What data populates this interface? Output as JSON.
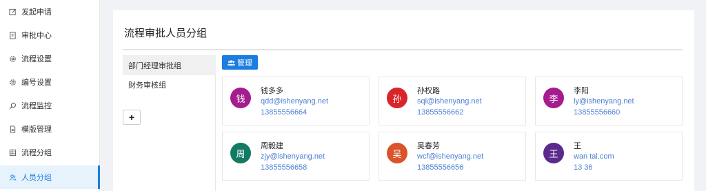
{
  "sidebar": {
    "items": [
      {
        "label": "发起申请",
        "icon": "edit-icon"
      },
      {
        "label": "审批中心",
        "icon": "document-check-icon"
      },
      {
        "label": "流程设置",
        "icon": "gear-icon"
      },
      {
        "label": "编号设置",
        "icon": "gear-icon"
      },
      {
        "label": "流程监控",
        "icon": "search-icon"
      },
      {
        "label": "模版管理",
        "icon": "file-icon"
      },
      {
        "label": "流程分组",
        "icon": "grid-icon"
      },
      {
        "label": "人员分组",
        "icon": "users-icon"
      }
    ],
    "active_index": 7
  },
  "page": {
    "title": "流程审批人员分组"
  },
  "groups": {
    "items": [
      {
        "label": "部门经理审批组"
      },
      {
        "label": "财务审核组"
      }
    ],
    "add_label": "+"
  },
  "toolbar": {
    "manage_label": "管理"
  },
  "members": [
    {
      "avatar_char": "钱",
      "color": "#a51c8f",
      "name": "钱多多",
      "email": "qdd@ishenyang.net",
      "phone": "13855556664"
    },
    {
      "avatar_char": "孙",
      "color": "#d8252a",
      "name": "孙权路",
      "email": "sql@ishenyang.net",
      "phone": "13855556662"
    },
    {
      "avatar_char": "李",
      "color": "#a51c8f",
      "name": "李阳",
      "email": "ly@ishenyang.net",
      "phone": "13855556660"
    },
    {
      "avatar_char": "周",
      "color": "#137a63",
      "name": "周毅建",
      "email": "zjy@ishenyang.net",
      "phone": "13855556658"
    },
    {
      "avatar_char": "吴",
      "color": "#d9542a",
      "name": "吴春芳",
      "email": "wcf@ishenyang.net",
      "phone": "13855556656"
    },
    {
      "avatar_char": "王",
      "color": "#5a2a8c",
      "name": "王",
      "email": "wan tal.com",
      "phone": "13 36"
    }
  ],
  "colors": {
    "accent": "#1a7de0",
    "link": "#4a7fd4"
  }
}
